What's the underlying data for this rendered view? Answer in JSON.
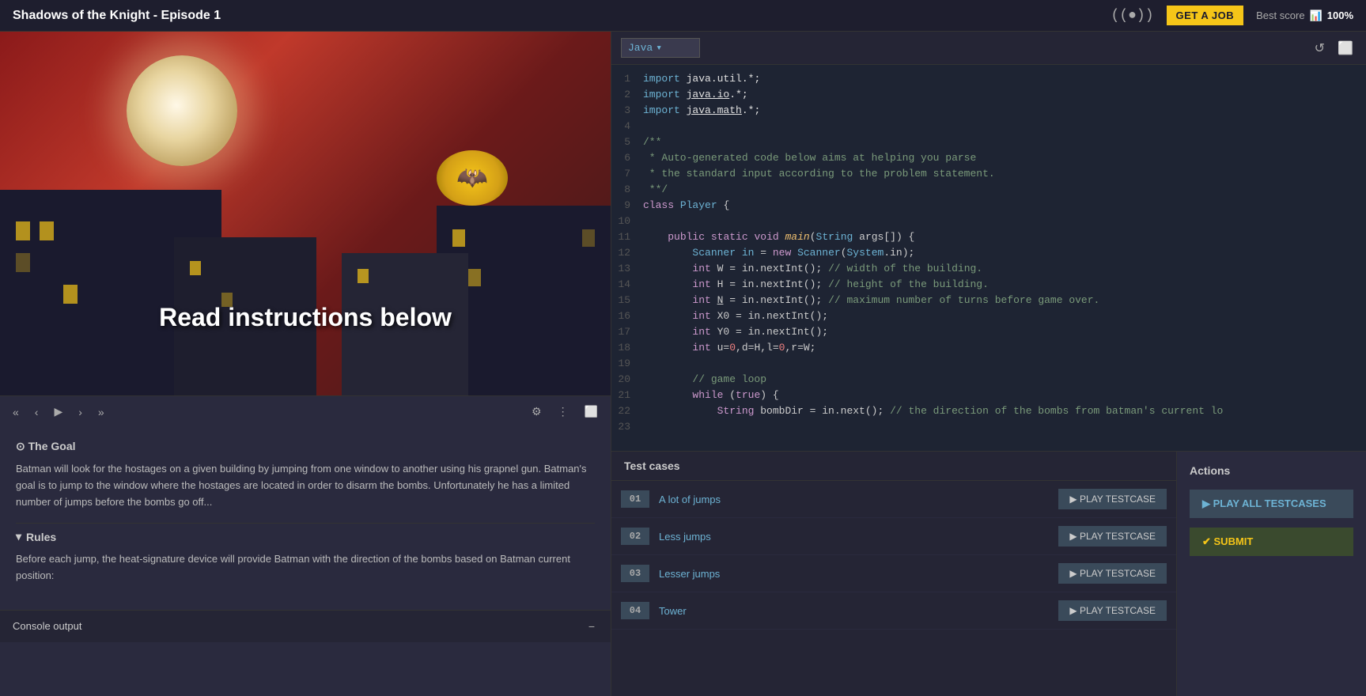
{
  "topbar": {
    "title": "Shadows of the Knight - Episode 1",
    "get_job_label": "GET A JOB",
    "best_score_label": "Best score",
    "best_score_value": "100%",
    "broadcast_icon": "((●))"
  },
  "video": {
    "overlay_text": "Read instructions below",
    "controls": {
      "rewind": "«",
      "prev": "‹",
      "play": "▶",
      "next": "›",
      "fast_forward": "»"
    }
  },
  "left_panel": {
    "goal_title": "⊙ The Goal",
    "goal_body": "Batman will look for the hostages on a given building by jumping from one window to another using his grapnel gun. Batman's goal is to jump to the window where the hostages are located in order to disarm the bombs. Unfortunately he has a limited number of jumps before the bombs go off...",
    "rules_title": "Rules",
    "rules_body": "Before each jump, the heat-signature device will provide Batman with the direction of the bombs based on Batman current position:"
  },
  "console": {
    "label": "Console output",
    "minimize_icon": "−"
  },
  "editor": {
    "language": "Java",
    "refresh_icon": "↺",
    "expand_icon": "⬜",
    "lines": [
      {
        "num": "1",
        "code": "import java.util.*;"
      },
      {
        "num": "2",
        "code": "import java.io.*;"
      },
      {
        "num": "3",
        "code": "import java.math.*;"
      },
      {
        "num": "4",
        "code": ""
      },
      {
        "num": "5",
        "code": "/**"
      },
      {
        "num": "6",
        "code": " * Auto-generated code below aims at helping you parse"
      },
      {
        "num": "7",
        "code": " * the standard input according to the problem statement."
      },
      {
        "num": "8",
        "code": " **/"
      },
      {
        "num": "9",
        "code": "class Player {"
      },
      {
        "num": "10",
        "code": ""
      },
      {
        "num": "11",
        "code": "    public static void main(String args[]) {"
      },
      {
        "num": "12",
        "code": "        Scanner in = new Scanner(System.in);"
      },
      {
        "num": "13",
        "code": "        int W = in.nextInt(); // width of the building."
      },
      {
        "num": "14",
        "code": "        int H = in.nextInt(); // height of the building."
      },
      {
        "num": "15",
        "code": "        int N = in.nextInt(); // maximum number of turns before game over."
      },
      {
        "num": "16",
        "code": "        int X0 = in.nextInt();"
      },
      {
        "num": "17",
        "code": "        int Y0 = in.nextInt();"
      },
      {
        "num": "18",
        "code": "        int u=0,d=H,l=0,r=W;"
      },
      {
        "num": "19",
        "code": ""
      },
      {
        "num": "20",
        "code": "        // game loop"
      },
      {
        "num": "21",
        "code": "        while (true) {"
      },
      {
        "num": "22",
        "code": "            String bombDir = in.next(); // the direction of the bombs from batman's current lo"
      },
      {
        "num": "23",
        "code": ""
      }
    ]
  },
  "test_cases": {
    "header": "Test cases",
    "play_label": "▶ PLAY TESTCASE",
    "items": [
      {
        "num": "01",
        "name": "A lot of jumps"
      },
      {
        "num": "02",
        "name": "Less jumps"
      },
      {
        "num": "03",
        "name": "Lesser jumps"
      },
      {
        "num": "04",
        "name": "Tower"
      }
    ]
  },
  "actions": {
    "header": "Actions",
    "play_all_label": "▶ PLAY ALL TESTCASES",
    "submit_label": "✔ SUBMIT"
  }
}
